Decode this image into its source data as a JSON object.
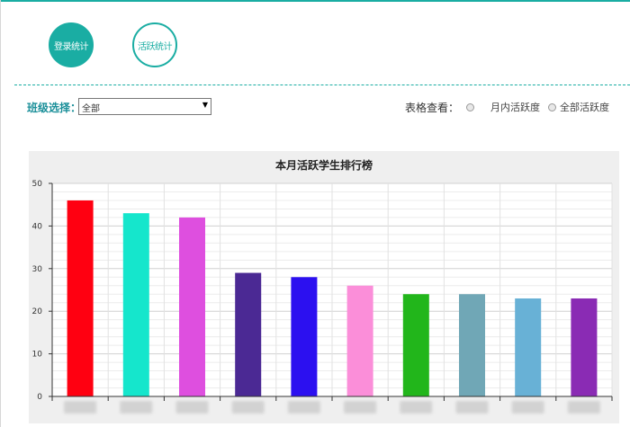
{
  "tabs": [
    {
      "label": "登录统计",
      "active": true
    },
    {
      "label": "活跃统计",
      "active": false
    }
  ],
  "filter": {
    "label": "班级选择：",
    "selected": "全部"
  },
  "view": {
    "label": "表格查看：",
    "options": [
      {
        "label": "月内活跃度",
        "checked": false
      },
      {
        "label": "全部活跃度",
        "checked": false
      }
    ]
  },
  "colors": {
    "accent": "#1aada3"
  },
  "chart_data": {
    "type": "bar",
    "title": "本月活跃学生排行榜",
    "ylim": [
      0,
      50
    ],
    "yticks": [
      0,
      10,
      20,
      30,
      40,
      50
    ],
    "values": [
      46,
      43,
      42,
      29,
      28,
      26,
      24,
      24,
      23,
      23
    ],
    "colors": [
      "#ff0011",
      "#15e6cc",
      "#de4fdf",
      "#4b2994",
      "#2c10f0",
      "#fb8ed9",
      "#22b61b",
      "#70a7b6",
      "#68b1d6",
      "#8a2bb4"
    ],
    "grid": true
  }
}
